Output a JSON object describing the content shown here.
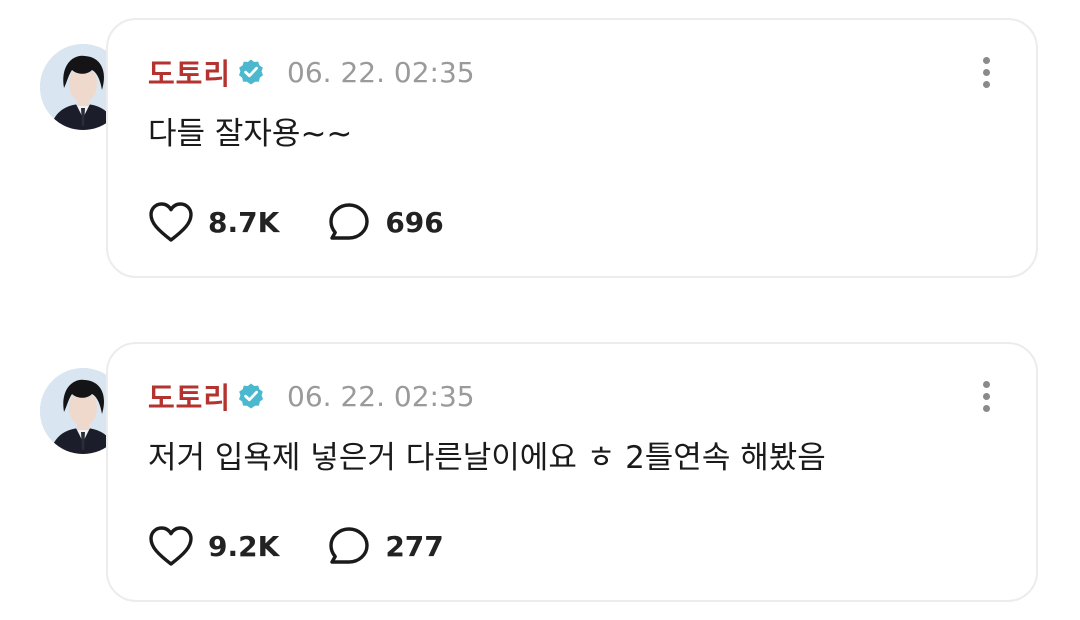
{
  "colors": {
    "username": "#b4332e",
    "verified_badge": "#4cb8cf",
    "timestamp": "#9a9a9a",
    "card_border": "#ececec"
  },
  "icons": {
    "verified": "verified-badge-icon",
    "more": "more-vertical-icon",
    "like": "heart-icon",
    "comment": "comment-bubble-icon"
  },
  "posts": [
    {
      "username": "도토리",
      "timestamp": "06. 22. 02:35",
      "text": "다들 잘자용~~",
      "likes": "8.7K",
      "comments": "696"
    },
    {
      "username": "도토리",
      "timestamp": "06. 22. 02:35",
      "text": "저거 입욕제 넣은거 다른날이에요 ㅎ 2틀연속 해봤음",
      "likes": "9.2K",
      "comments": "277"
    }
  ]
}
